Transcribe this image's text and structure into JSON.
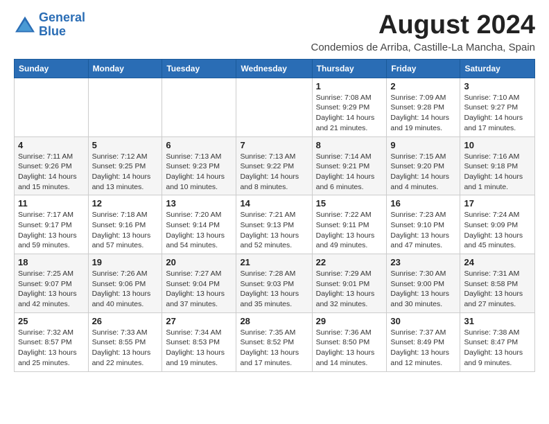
{
  "logo": {
    "line1": "General",
    "line2": "Blue"
  },
  "title": "August 2024",
  "subtitle": "Condemios de Arriba, Castille-La Mancha, Spain",
  "days_of_week": [
    "Sunday",
    "Monday",
    "Tuesday",
    "Wednesday",
    "Thursday",
    "Friday",
    "Saturday"
  ],
  "weeks": [
    [
      {
        "day": "",
        "content": ""
      },
      {
        "day": "",
        "content": ""
      },
      {
        "day": "",
        "content": ""
      },
      {
        "day": "",
        "content": ""
      },
      {
        "day": "1",
        "content": "Sunrise: 7:08 AM\nSunset: 9:29 PM\nDaylight: 14 hours and 21 minutes."
      },
      {
        "day": "2",
        "content": "Sunrise: 7:09 AM\nSunset: 9:28 PM\nDaylight: 14 hours and 19 minutes."
      },
      {
        "day": "3",
        "content": "Sunrise: 7:10 AM\nSunset: 9:27 PM\nDaylight: 14 hours and 17 minutes."
      }
    ],
    [
      {
        "day": "4",
        "content": "Sunrise: 7:11 AM\nSunset: 9:26 PM\nDaylight: 14 hours and 15 minutes."
      },
      {
        "day": "5",
        "content": "Sunrise: 7:12 AM\nSunset: 9:25 PM\nDaylight: 14 hours and 13 minutes."
      },
      {
        "day": "6",
        "content": "Sunrise: 7:13 AM\nSunset: 9:23 PM\nDaylight: 14 hours and 10 minutes."
      },
      {
        "day": "7",
        "content": "Sunrise: 7:13 AM\nSunset: 9:22 PM\nDaylight: 14 hours and 8 minutes."
      },
      {
        "day": "8",
        "content": "Sunrise: 7:14 AM\nSunset: 9:21 PM\nDaylight: 14 hours and 6 minutes."
      },
      {
        "day": "9",
        "content": "Sunrise: 7:15 AM\nSunset: 9:20 PM\nDaylight: 14 hours and 4 minutes."
      },
      {
        "day": "10",
        "content": "Sunrise: 7:16 AM\nSunset: 9:18 PM\nDaylight: 14 hours and 1 minute."
      }
    ],
    [
      {
        "day": "11",
        "content": "Sunrise: 7:17 AM\nSunset: 9:17 PM\nDaylight: 13 hours and 59 minutes."
      },
      {
        "day": "12",
        "content": "Sunrise: 7:18 AM\nSunset: 9:16 PM\nDaylight: 13 hours and 57 minutes."
      },
      {
        "day": "13",
        "content": "Sunrise: 7:20 AM\nSunset: 9:14 PM\nDaylight: 13 hours and 54 minutes."
      },
      {
        "day": "14",
        "content": "Sunrise: 7:21 AM\nSunset: 9:13 PM\nDaylight: 13 hours and 52 minutes."
      },
      {
        "day": "15",
        "content": "Sunrise: 7:22 AM\nSunset: 9:11 PM\nDaylight: 13 hours and 49 minutes."
      },
      {
        "day": "16",
        "content": "Sunrise: 7:23 AM\nSunset: 9:10 PM\nDaylight: 13 hours and 47 minutes."
      },
      {
        "day": "17",
        "content": "Sunrise: 7:24 AM\nSunset: 9:09 PM\nDaylight: 13 hours and 45 minutes."
      }
    ],
    [
      {
        "day": "18",
        "content": "Sunrise: 7:25 AM\nSunset: 9:07 PM\nDaylight: 13 hours and 42 minutes."
      },
      {
        "day": "19",
        "content": "Sunrise: 7:26 AM\nSunset: 9:06 PM\nDaylight: 13 hours and 40 minutes."
      },
      {
        "day": "20",
        "content": "Sunrise: 7:27 AM\nSunset: 9:04 PM\nDaylight: 13 hours and 37 minutes."
      },
      {
        "day": "21",
        "content": "Sunrise: 7:28 AM\nSunset: 9:03 PM\nDaylight: 13 hours and 35 minutes."
      },
      {
        "day": "22",
        "content": "Sunrise: 7:29 AM\nSunset: 9:01 PM\nDaylight: 13 hours and 32 minutes."
      },
      {
        "day": "23",
        "content": "Sunrise: 7:30 AM\nSunset: 9:00 PM\nDaylight: 13 hours and 30 minutes."
      },
      {
        "day": "24",
        "content": "Sunrise: 7:31 AM\nSunset: 8:58 PM\nDaylight: 13 hours and 27 minutes."
      }
    ],
    [
      {
        "day": "25",
        "content": "Sunrise: 7:32 AM\nSunset: 8:57 PM\nDaylight: 13 hours and 25 minutes."
      },
      {
        "day": "26",
        "content": "Sunrise: 7:33 AM\nSunset: 8:55 PM\nDaylight: 13 hours and 22 minutes."
      },
      {
        "day": "27",
        "content": "Sunrise: 7:34 AM\nSunset: 8:53 PM\nDaylight: 13 hours and 19 minutes."
      },
      {
        "day": "28",
        "content": "Sunrise: 7:35 AM\nSunset: 8:52 PM\nDaylight: 13 hours and 17 minutes."
      },
      {
        "day": "29",
        "content": "Sunrise: 7:36 AM\nSunset: 8:50 PM\nDaylight: 13 hours and 14 minutes."
      },
      {
        "day": "30",
        "content": "Sunrise: 7:37 AM\nSunset: 8:49 PM\nDaylight: 13 hours and 12 minutes."
      },
      {
        "day": "31",
        "content": "Sunrise: 7:38 AM\nSunset: 8:47 PM\nDaylight: 13 hours and 9 minutes."
      }
    ]
  ]
}
